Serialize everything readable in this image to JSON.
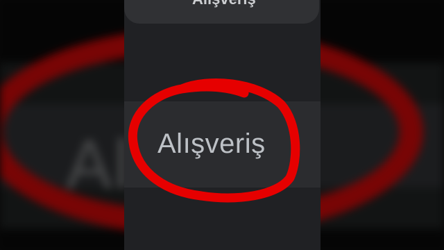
{
  "search": {
    "query": "Alışveriş",
    "back_icon": "back-arrow-icon"
  },
  "chip": {
    "label": "Alışveriş"
  },
  "backdrop": {
    "label": "Alış"
  },
  "annotation": {
    "color": "#e60000"
  },
  "colors": {
    "screen_bg": "#202124",
    "bar_bg": "#303134",
    "text": "#bdc1c6"
  }
}
